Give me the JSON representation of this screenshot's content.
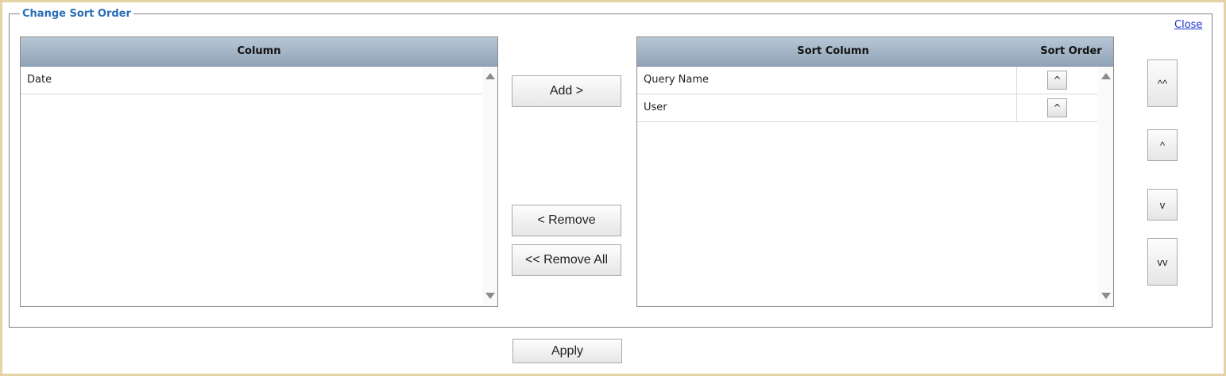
{
  "dialog": {
    "title": "Change Sort Order",
    "close_label": "Close"
  },
  "available": {
    "header": "Column",
    "rows": [
      "Date"
    ]
  },
  "transfer": {
    "add_label": "Add >",
    "remove_label": "< Remove",
    "remove_all_label": "<< Remove All"
  },
  "sorted": {
    "header_column": "Sort Column",
    "header_order": "Sort Order",
    "rows": [
      {
        "column": "Query Name",
        "order": "^"
      },
      {
        "column": "User",
        "order": "^"
      }
    ]
  },
  "reorder": {
    "top_label": "^^",
    "up_label": "^",
    "down_label": "v",
    "bottom_label": "vv"
  },
  "footer": {
    "apply_label": "Apply"
  }
}
